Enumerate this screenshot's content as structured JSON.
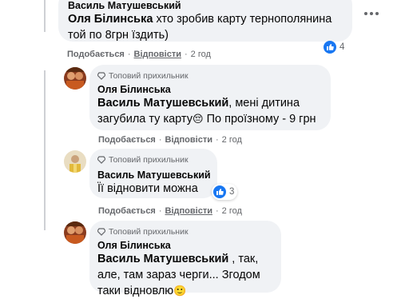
{
  "comment_top": {
    "author": "Василь Матушевський",
    "mention": "Оля Білинська",
    "text": " хто зробив карту тернополянина той по 8грн їздить)",
    "actions": {
      "like": "Подобається",
      "reply": "Відповісти",
      "time": "2 год"
    },
    "reaction_count": "4"
  },
  "reply_1": {
    "badge": "Топовий прихильник",
    "author": "Оля Білинська",
    "mention": "Василь Матушевський",
    "text_a": ", мені дитина загубила ту карту",
    "emoji": "😔",
    "text_b": " По проїзному - 9 грн",
    "actions": {
      "like": "Подобається",
      "reply": "Відповісти",
      "time": "2 год"
    }
  },
  "reply_2": {
    "badge": "Топовий прихильник",
    "author": "Василь Матушевський",
    "text": "Її відновити можна",
    "reaction_count": "3",
    "actions": {
      "like": "Подобається",
      "reply": "Відповісти",
      "time": "2 год"
    }
  },
  "reply_3": {
    "badge": "Топовий прихильник",
    "author": "Оля Білинська",
    "mention": "Василь Матушевський",
    "text": " , так, але, там зараз черги... Згодом таки відновлю",
    "emoji": "🙂"
  },
  "colors": {
    "bubble": "#f0f2f5",
    "like": "#1877f2",
    "meta": "#65676b"
  }
}
